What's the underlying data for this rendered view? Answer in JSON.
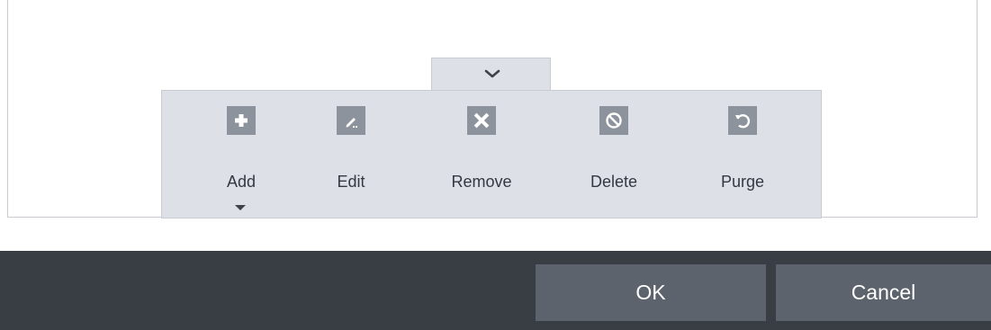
{
  "toolbar": {
    "tools": [
      {
        "label": "Add",
        "icon": "plus-icon"
      },
      {
        "label": "Edit",
        "icon": "pencil-icon"
      },
      {
        "label": "Remove",
        "icon": "x-icon"
      },
      {
        "label": "Delete",
        "icon": "block-icon"
      },
      {
        "label": "Purge",
        "icon": "undo-icon"
      }
    ],
    "collapse_icon": "chevron-down-icon",
    "add_dropdown_icon": "caret-down-icon"
  },
  "footer": {
    "ok_label": "OK",
    "cancel_label": "Cancel"
  },
  "colors": {
    "toolbar_bg": "#dde0e6",
    "icon_tile": "#8d939c",
    "footer_bg": "#393d44",
    "button_bg": "#5d636c",
    "text": "#333941"
  }
}
